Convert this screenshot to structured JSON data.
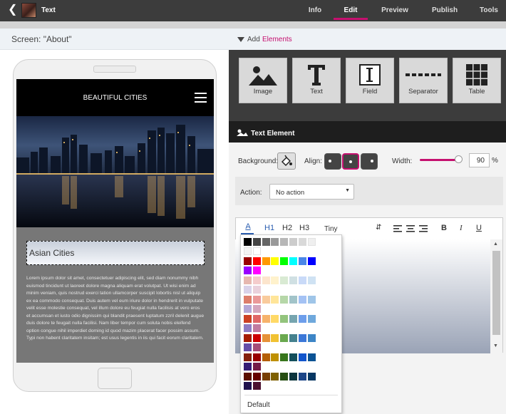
{
  "topbar": {
    "back_icon": "chevron-left-icon",
    "title": "Text",
    "tabs": [
      "Info",
      "Edit",
      "Preview",
      "Publish",
      "Tools"
    ],
    "active_tab": "Edit",
    "accent_color": "#c5106f"
  },
  "screen_label": "Screen: \"About\"",
  "add_elements": {
    "prefix": "Add",
    "suffix": "Elements"
  },
  "element_buttons": [
    {
      "label": "Image",
      "icon": "image-icon"
    },
    {
      "label": "Text",
      "icon": "text-icon"
    },
    {
      "label": "Field",
      "icon": "field-icon"
    },
    {
      "label": "Separator",
      "icon": "separator-icon"
    },
    {
      "label": "Table",
      "icon": "table-icon"
    }
  ],
  "section_title": "Text Element",
  "phone": {
    "app_title": "BEAUTIFUL CITIES",
    "heading": "Asian Cities",
    "body": "Lorem ipsum dolor sit amet, consectetuer adipiscing elit, sed diam nonummy nibh euismod tincidunt ut laoreet dolore magna aliquam erat volutpat. Ut wisi enim ad minim veniam, quis nostrud exerci tation ullamcorper suscipit lobortis nisl ut aliquip ex ea commodo consequat. Duis autem vel eum iriure dolor in hendrerit in vulputate velit esse molestie consequat, vel illum dolore eu feugiat nulla facilisis at vero eros et accumsan et iusto odio dignissim qui blandit praesent luptatum zzril delenit augue duis dolore te feugait nulla facilisi. Nam liber tempor cum soluta nobis eleifend option congue nihil imperdiet doming id quod mazim placerat facer possim assum. Typi non habent claritatem insitam; est usus legentis in iis qui facit eorum claritatem."
  },
  "props": {
    "background_label": "Background:",
    "align_label": "Align:",
    "align_selected": "center",
    "width_label": "Width:",
    "width_value": "90",
    "width_unit": "%",
    "width_fraction": 0.9,
    "action_label": "Action:",
    "action_value": "No action"
  },
  "toolbar": {
    "font_color_icon": "font-color-icon",
    "h1": "H1",
    "h2": "H2",
    "h3": "H3",
    "size": "Tiny",
    "bold": "B",
    "italic": "I",
    "underline": "U"
  },
  "palette": {
    "default_label": "Default",
    "grays": [
      "#000000",
      "#434343",
      "#666666",
      "#999999",
      "#b7b7b7",
      "#cccccc",
      "#d9d9d9",
      "#efefef",
      "#f3f3f3",
      "#ffffff"
    ],
    "brights": [
      "#980000",
      "#ff0000",
      "#ff9900",
      "#ffff00",
      "#00ff00",
      "#00ffff",
      "#4a86e8",
      "#0000ff",
      "#9900ff",
      "#ff00ff"
    ],
    "shades": [
      [
        "#e6b8af",
        "#f4cccc",
        "#fce5cd",
        "#fff2cc",
        "#d9ead3",
        "#d0e0e3",
        "#c9daf8",
        "#cfe2f3",
        "#d9d2e9",
        "#ead1dc"
      ],
      [
        "#dd7e6b",
        "#ea9999",
        "#f9cb9c",
        "#ffe599",
        "#b6d7a8",
        "#a2c4c9",
        "#a4c2f4",
        "#9fc5e8",
        "#b4a7d6",
        "#d5a6bd"
      ],
      [
        "#cc4125",
        "#e06666",
        "#f6b26b",
        "#ffd966",
        "#93c47d",
        "#76a5af",
        "#6d9eeb",
        "#6fa8dc",
        "#8e7cc3",
        "#c27ba0"
      ],
      [
        "#a61c00",
        "#cc0000",
        "#e69138",
        "#f1c232",
        "#6aa84f",
        "#45818e",
        "#3c78d8",
        "#3d85c6",
        "#674ea7",
        "#a64d79"
      ],
      [
        "#85200c",
        "#990000",
        "#b45f06",
        "#bf9000",
        "#38761d",
        "#134f5c",
        "#1155cc",
        "#0b5394",
        "#351c75",
        "#741b47"
      ],
      [
        "#5b0f00",
        "#660000",
        "#783f04",
        "#7f6000",
        "#274e13",
        "#0c343d",
        "#1c4587",
        "#073763",
        "#20124d",
        "#4c1130"
      ]
    ]
  }
}
